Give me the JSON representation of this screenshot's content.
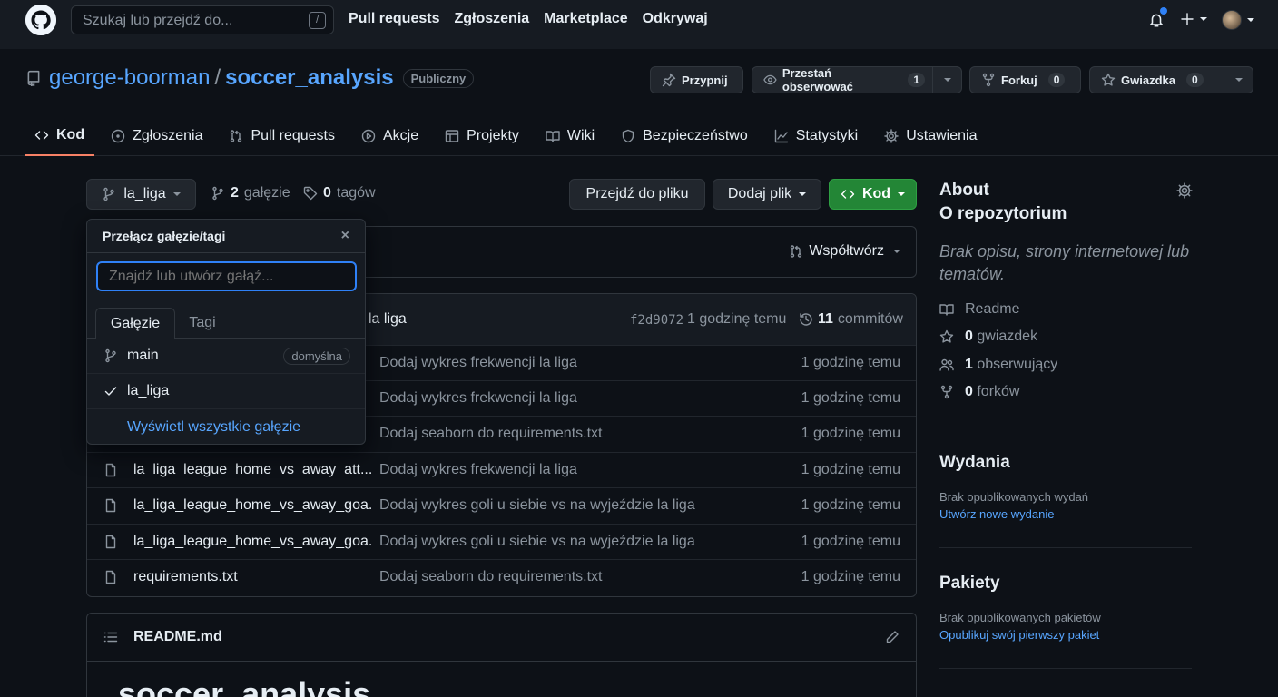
{
  "header": {
    "search_placeholder": "Szukaj lub przejdź do...",
    "search_key": "/",
    "nav": [
      "Pull requests",
      "Zgłoszenia",
      "Marketplace",
      "Odkrywaj"
    ]
  },
  "repo": {
    "owner": "george-boorman",
    "separator": "/",
    "name": "soccer_analysis",
    "visibility": "Publiczny",
    "pin_label": "Przypnij",
    "watch_label": "Przestań obserwować",
    "watch_count": "1",
    "fork_label": "Forkuj",
    "fork_count": "0",
    "star_label": "Gwiazdka",
    "star_count": "0"
  },
  "tabs": [
    "Kod",
    "Zgłoszenia",
    "Pull requests",
    "Akcje",
    "Projekty",
    "Wiki",
    "Bezpieczeństwo",
    "Statystyki",
    "Ustawienia"
  ],
  "branchbar": {
    "branch": "la_liga",
    "branches_count": "2",
    "branches_label": "gałęzie",
    "tags_count": "0",
    "tags_label": "tagów",
    "goto_file": "Przejdź do pliku",
    "add_file": "Dodaj plik",
    "code": "Kod"
  },
  "contribute": "Współtwórz",
  "commit": {
    "message_tail": "la liga",
    "hash": "f2d9072",
    "time": "1 godzinę temu",
    "commits_count": "11",
    "commits_label": "commitów"
  },
  "files": [
    {
      "message": "Dodaj wykres frekwencji la liga",
      "age": "1 godzinę temu"
    },
    {
      "message": "Dodaj wykres frekwencji la liga",
      "age": "1 godzinę temu"
    },
    {
      "message": "Dodaj seaborn do requirements.txt",
      "age": "1 godzinę temu"
    },
    {
      "name": "la_liga_league_home_vs_away_att...",
      "message": "Dodaj wykres frekwencji la liga",
      "age": "1 godzinę temu"
    },
    {
      "name": "la_liga_league_home_vs_away_goa...",
      "message": "Dodaj wykres goli u siebie vs na wyjeździe la liga",
      "age": "1 godzinę temu"
    },
    {
      "name": "la_liga_league_home_vs_away_goa...",
      "message": "Dodaj wykres goli u siebie vs na wyjeździe la liga",
      "age": "1 godzinę temu"
    },
    {
      "name": "requirements.txt",
      "message": "Dodaj seaborn do requirements.txt",
      "age": "1 godzinę temu"
    }
  ],
  "readme": {
    "file": "README.md",
    "heading": "soccer_analysis"
  },
  "dropdown": {
    "title": "Przełącz gałęzie/tagi",
    "close": "×",
    "placeholder": "Znajdź lub utwórz gałąź...",
    "tab_branches": "Gałęzie",
    "tab_tags": "Tagi",
    "items": [
      {
        "label": "main",
        "badge": "domyślna"
      },
      {
        "label": "la_liga"
      }
    ],
    "view_all": "Wyświetl wszystkie gałęzie"
  },
  "sidebar": {
    "about_title": "About",
    "about_subtitle": "O repozytorium",
    "description": "Brak opisu, strony internetowej lub tematów.",
    "readme": "Readme",
    "stars_count": "0",
    "stars_label": "gwiazdek",
    "watchers_count": "1",
    "watchers_label": "obserwujący",
    "forks_count": "0",
    "forks_label": "forków",
    "releases_title": "Wydania",
    "releases_empty": "Brak opublikowanych wydań",
    "releases_link": "Utwórz nowe wydanie",
    "packages_title": "Pakiety",
    "packages_empty": "Brak opublikowanych pakietów",
    "packages_link": "Opublikuj swój pierwszy pakiet"
  },
  "colors": {
    "accent": "#2f81f7",
    "link": "#58a6ff",
    "green_button": "#238636",
    "active_tab_underline": "#f78166"
  }
}
